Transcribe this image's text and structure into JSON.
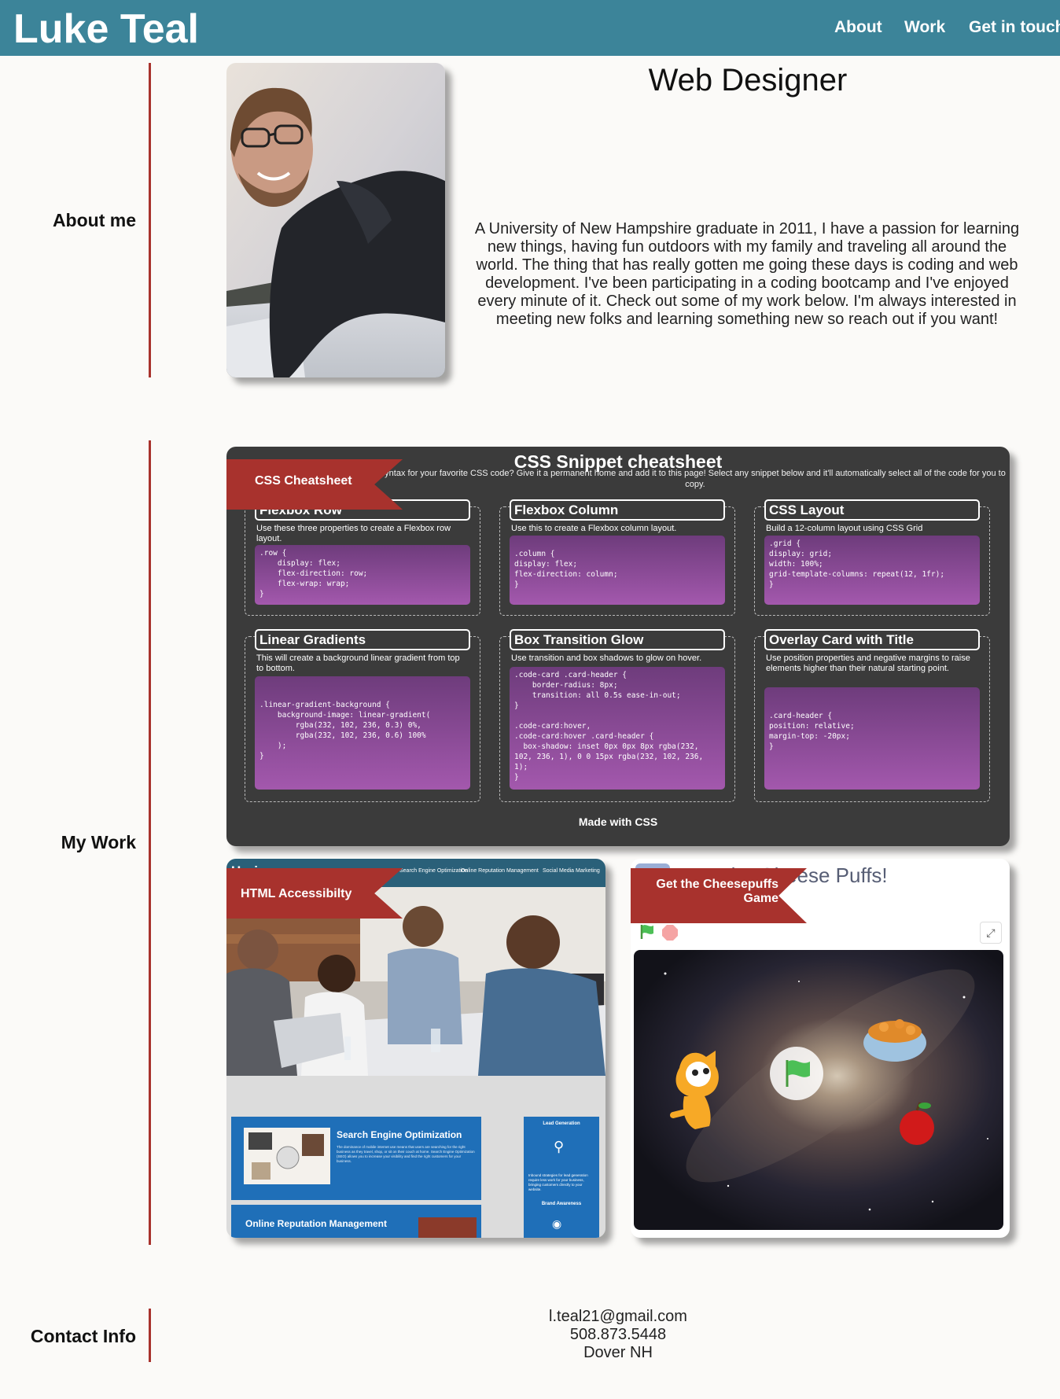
{
  "header": {
    "brand": "Luke Teal",
    "nav": [
      "About",
      "Work",
      "Get in touch"
    ]
  },
  "about": {
    "label": "About me",
    "title": "Web Designer",
    "bio": "A University of New Hampshire graduate in 2011, I have a passion for learning new things, having fun outdoors with my family and traveling all around the world. The thing that has really gotten me going these days is coding and web development. I've been participating in a coding bootcamp and I've enjoyed every minute of it. Check out some of my work below. I'm always interested in meeting new folks and learning something new so reach out if you want!"
  },
  "work": {
    "label": "My Work",
    "cheatsheet": {
      "ribbon": "CSS Cheatsheet",
      "title": "CSS Snippet cheatsheet",
      "subtitle": "yntax for your favorite CSS code? Give it a permanent home and add it to this page! Select any snippet below and it'll automatically select all of the code for you to copy.",
      "snippets": [
        {
          "title": "Flexbox Row",
          "desc": "Use these three properties to create a Flexbox row layout.",
          "code": ".row {\n    display: flex;\n    flex-direction: row;\n    flex-wrap: wrap;\n}"
        },
        {
          "title": "Flexbox Column",
          "desc": "Use this to create a Flexbox column layout.",
          "code": "\n.column {\ndisplay: flex;\nflex-direction: column;\n}"
        },
        {
          "title": "CSS Layout",
          "desc": "Build a 12-column layout using CSS Grid",
          "code": ".grid {\ndisplay: grid;\nwidth: 100%;\ngrid-template-columns: repeat(12, 1fr);\n}"
        },
        {
          "title": "Linear Gradients",
          "desc": "This will create a background linear gradient from top to bottom.",
          "code": "\n\n.linear-gradient-background {\n    background-image: linear-gradient(\n        rgba(232, 102, 236, 0.3) 0%,\n        rgba(232, 102, 236, 0.6) 100%\n    );\n}"
        },
        {
          "title": "Box Transition Glow",
          "desc": "Use transition and box shadows to glow on hover.",
          "code": ".code-card .card-header {\n    border-radius: 8px;\n    transition: all 0.5s ease-in-out;\n}\n\n.code-card:hover,\n.code-card:hover .card-header {\n  box-shadow: inset 0px 0px 8px rgba(232,\n102, 236, 1), 0 0 15px rgba(232, 102, 236,\n1);\n}"
        },
        {
          "title": "Overlay Card with Title",
          "desc": "Use position properties and negative margins to raise elements higher than their natural starting point.",
          "code": "\n\n.card-header {\nposition: relative;\nmargin-top: -20px;\n}"
        }
      ],
      "footer": "Made with CSS"
    },
    "accessibility": {
      "ribbon": "HTML Accessibilty",
      "site_title": "Horiseon",
      "site_nav": [
        "Search Engine Optimization",
        "Online Reputation Management",
        "Social Media Marketing"
      ],
      "seo_heading": "Search Engine Optimization",
      "seo_text": "The dominance of mobile internet use means that users are searching for the right business as they travel, shop, or sit on their couch at home. Search Engine Optimization (SEO) allows you to increase your visibility and find the right customers for your business.",
      "side_heading": "Lead Generation",
      "side_text": "Inbound strategies for lead generation require less work for your business, bringing customers directly to your website.",
      "side_heading2": "Brand Awareness",
      "orm_heading": "Online Reputation Management"
    },
    "game": {
      "ribbon": "Get the Cheesepuffs Game",
      "title": "Eat The Cheese Puffs!"
    }
  },
  "contact": {
    "label": "Contact Info",
    "email": "l.teal21@gmail.com",
    "phone": "508.873.5448",
    "location": "Dover NH"
  }
}
